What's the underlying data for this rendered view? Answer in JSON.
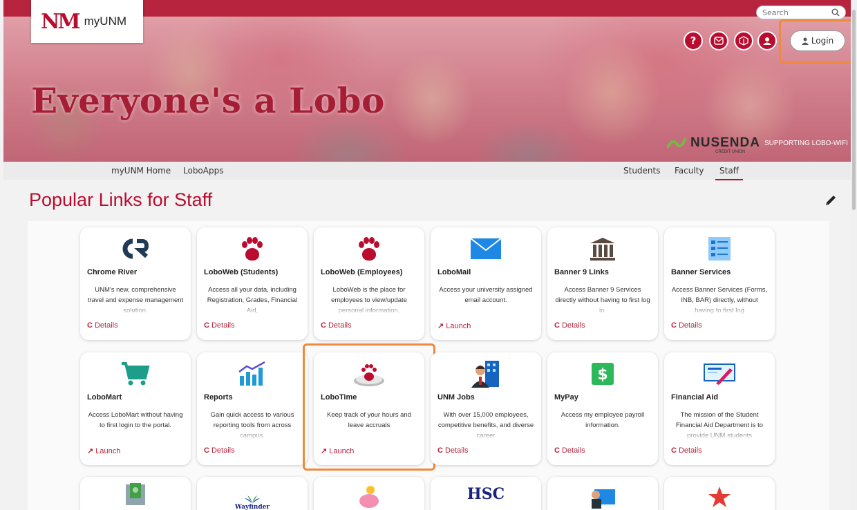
{
  "brand": {
    "mark": "NM",
    "name": "myUNM"
  },
  "search": {
    "placeholder": "Search"
  },
  "header": {
    "hero_title": "Everyone's a Lobo",
    "sponsor": {
      "name": "NUSENDA",
      "sub": "CREDIT UNION",
      "tagline": "SUPPORTING LOBO-WIFI"
    },
    "icons": [
      {
        "label": "?"
      },
      {
        "label": "✉"
      },
      {
        "label": "⏏"
      },
      {
        "label": "☗"
      }
    ],
    "login_label": "Login"
  },
  "nav": {
    "left": [
      "myUNM Home",
      "LoboApps"
    ],
    "right": [
      "Students",
      "Faculty",
      "Staff"
    ],
    "active": "Staff"
  },
  "page": {
    "title": "Popular Links for Staff"
  },
  "cards": [
    {
      "title": "Chrome River",
      "desc": "UNM's new, comprehensive travel and expense management solution.",
      "action": "Details",
      "icon": "chrome-river-icon"
    },
    {
      "title": "LoboWeb (Students)",
      "desc": "Access all your data, including Registration, Grades, Financial Aid,",
      "action": "Details",
      "icon": "paw-icon"
    },
    {
      "title": "LoboWeb (Employees)",
      "desc": "LoboWeb is the place for employees to view/update personal information,",
      "action": "Details",
      "icon": "paw-icon"
    },
    {
      "title": "LoboMail",
      "desc": "Access your university assigned email account.",
      "action": "Launch",
      "icon": "envelope-icon"
    },
    {
      "title": "Banner 9 Links",
      "desc": "Access Banner 9 Services directly without having to first log in.",
      "action": "Details",
      "icon": "bank-icon"
    },
    {
      "title": "Banner Services",
      "desc": "Access Banner Services (Forms, INB, BAR) directly, without having to first log",
      "action": "Details",
      "icon": "list-icon"
    },
    {
      "title": "LoboMart",
      "desc": "Access LoboMart without having to first login to the portal.",
      "action": "Launch",
      "icon": "cart-icon"
    },
    {
      "title": "Reports",
      "desc": "Gain quick access to various reporting tools from across campus.",
      "action": "Details",
      "icon": "bar-chart-icon"
    },
    {
      "title": "LoboTime",
      "desc": "Keep track of your hours and leave accruals",
      "action": "Launch",
      "icon": "clock-paw-icon"
    },
    {
      "title": "UNM Jobs",
      "desc": "With over 15,000 employees, competitive benefits, and diverse career",
      "action": "Details",
      "icon": "job-person-icon"
    },
    {
      "title": "MyPay",
      "desc": "Access my employee payroll information.",
      "action": "Details",
      "icon": "dollar-icon"
    },
    {
      "title": "Financial Aid",
      "desc": "The mission of the Student Financial Aid Department is to provide UNM students",
      "action": "Details",
      "icon": "check-icon"
    }
  ],
  "bottom_row": [
    {
      "icon": "money-envelope-icon"
    },
    {
      "icon": "wayfinder-icon",
      "label": "Wayfinder"
    },
    {
      "icon": "piggy-bank-icon"
    },
    {
      "icon": "hsc-link-icon",
      "label": "HSC"
    },
    {
      "icon": "teacher-board-icon"
    },
    {
      "icon": "star-icon"
    }
  ],
  "colors": {
    "accent": "#ba0c2f",
    "highlight": "#f0893b"
  }
}
